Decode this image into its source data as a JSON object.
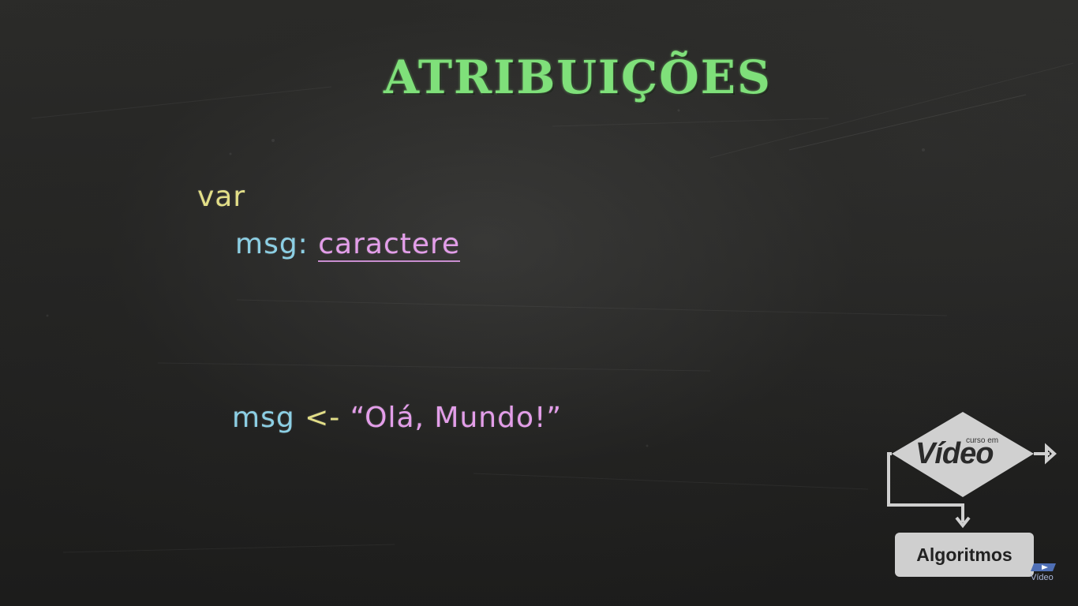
{
  "slide": {
    "title": "ATRIBUIÇÕES",
    "code": {
      "var_keyword": "var",
      "decl_identifier": "msg:",
      "decl_type": "caractere",
      "assign_identifier": "msg",
      "assign_operator": "<-",
      "assign_value": "“Olá, Mundo!”"
    }
  },
  "logo": {
    "curso_label": "curso em",
    "video_label": "Vídeo",
    "course_label": "Algoritmos",
    "mini_label": "Vídeo"
  },
  "colors": {
    "title": "#7fe07a",
    "keyword": "#e2de87",
    "identifier": "#8ccfe4",
    "string": "#e39ee9"
  }
}
